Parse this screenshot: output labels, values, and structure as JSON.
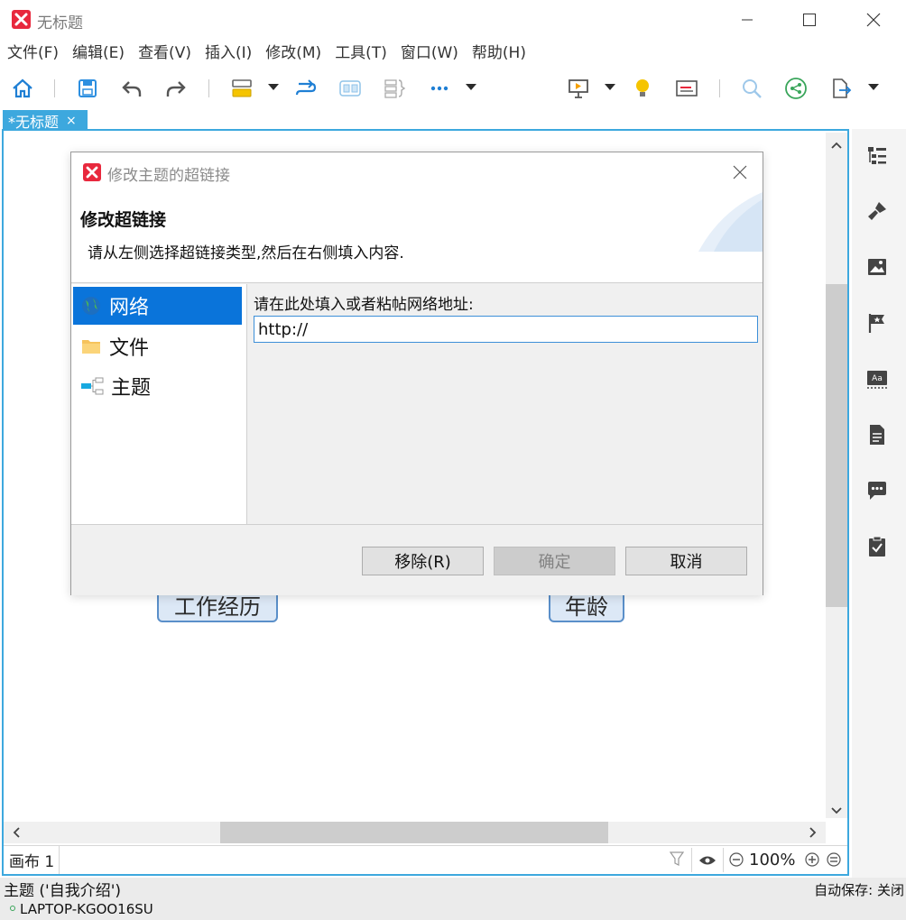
{
  "window": {
    "title": "无标题"
  },
  "menu": [
    "文件(F)",
    "编辑(E)",
    "查看(V)",
    "插入(I)",
    "修改(M)",
    "工具(T)",
    "窗口(W)",
    "帮助(H)"
  ],
  "toolbar": {
    "icons": [
      "home-icon",
      "save-icon",
      "undo-icon",
      "redo-icon",
      "insert-topic-icon",
      "relationship-icon",
      "boundary-icon",
      "summary-icon",
      "more-icon",
      "presentation-icon",
      "idea-icon",
      "layout-icon",
      "search-icon",
      "share-icon",
      "export-icon"
    ]
  },
  "editor": {
    "tab_label": "*无标题",
    "tab_close": "×",
    "nodes": [
      {
        "label": "工作经历"
      },
      {
        "label": "年龄"
      }
    ],
    "sheet_tab": "画布 1",
    "zoom": "100%"
  },
  "dialog": {
    "title": "修改主题的超链接",
    "heading": "修改超链接",
    "description": "请从左侧选择超链接类型,然后在右侧填入内容.",
    "link_types": [
      {
        "label": "网络",
        "icon": "globe-icon",
        "selected": true
      },
      {
        "label": "文件",
        "icon": "folder-icon",
        "selected": false
      },
      {
        "label": "主题",
        "icon": "topic-icon",
        "selected": false
      }
    ],
    "url_prompt": "请在此处填入或者粘帖网络地址:",
    "url_value": "http://",
    "buttons": {
      "remove": "移除(R)",
      "ok": "确定",
      "cancel": "取消"
    }
  },
  "status": {
    "selection": "主题 ('自我介绍')",
    "autosave": "自动保存: 关闭",
    "user": "LAPTOP-KGOO16SU"
  },
  "colors": {
    "accent": "#3da8de",
    "selection": "#0a74da",
    "logo": "#e8283d"
  }
}
